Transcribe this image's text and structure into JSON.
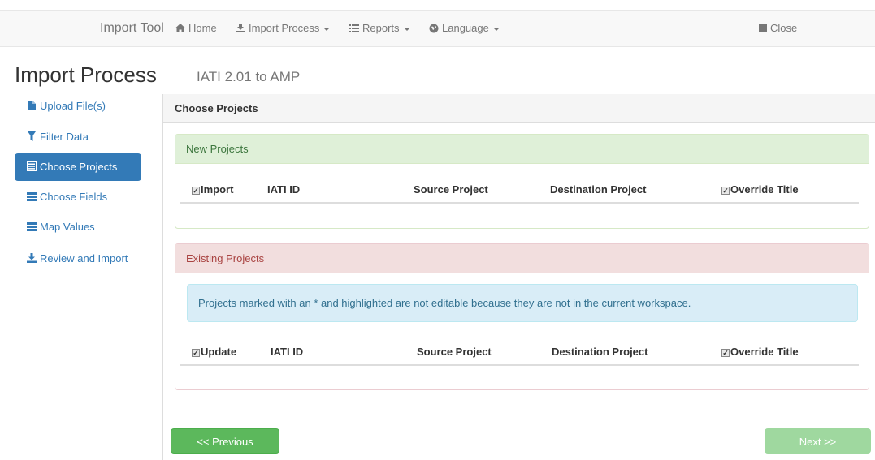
{
  "navbar": {
    "brand": "Import Tool",
    "home": "Home",
    "import_process": "Import Process",
    "reports": "Reports",
    "language": "Language",
    "close": "Close"
  },
  "header": {
    "title": "Import Process",
    "subtitle": "IATI 2.01 to AMP"
  },
  "sidebar": {
    "items": [
      {
        "label": "Upload File(s)",
        "icon": "file-icon",
        "active": false
      },
      {
        "label": "Filter Data",
        "icon": "filter-icon",
        "active": false
      },
      {
        "label": "Choose Projects",
        "icon": "list-icon",
        "active": true
      },
      {
        "label": "Choose Fields",
        "icon": "tasks-icon",
        "active": false
      },
      {
        "label": "Map Values",
        "icon": "tasks-icon",
        "active": false
      },
      {
        "label": "Review and Import",
        "icon": "download-icon",
        "active": false
      }
    ]
  },
  "main": {
    "section_title": "Choose Projects",
    "new_projects": {
      "title": "New Projects",
      "columns": [
        "Import",
        "IATI ID",
        "Source Project",
        "Destination Project",
        "Override Title"
      ]
    },
    "existing_projects": {
      "title": "Existing Projects",
      "info": "Projects marked with an * and highlighted are not editable because they are not in the current workspace.",
      "columns": [
        "Update",
        "IATI ID",
        "Source Project",
        "Destination Project",
        "Override Title"
      ]
    }
  },
  "buttons": {
    "previous": "<< Previous",
    "next": "Next >>"
  },
  "colors": {
    "primary": "#337ab7",
    "success": "#5cb85c",
    "success_disabled": "#9fd89f",
    "panel_success_bg": "#dff0d8",
    "panel_danger_bg": "#f2dede",
    "info_bg": "#d9edf7"
  }
}
